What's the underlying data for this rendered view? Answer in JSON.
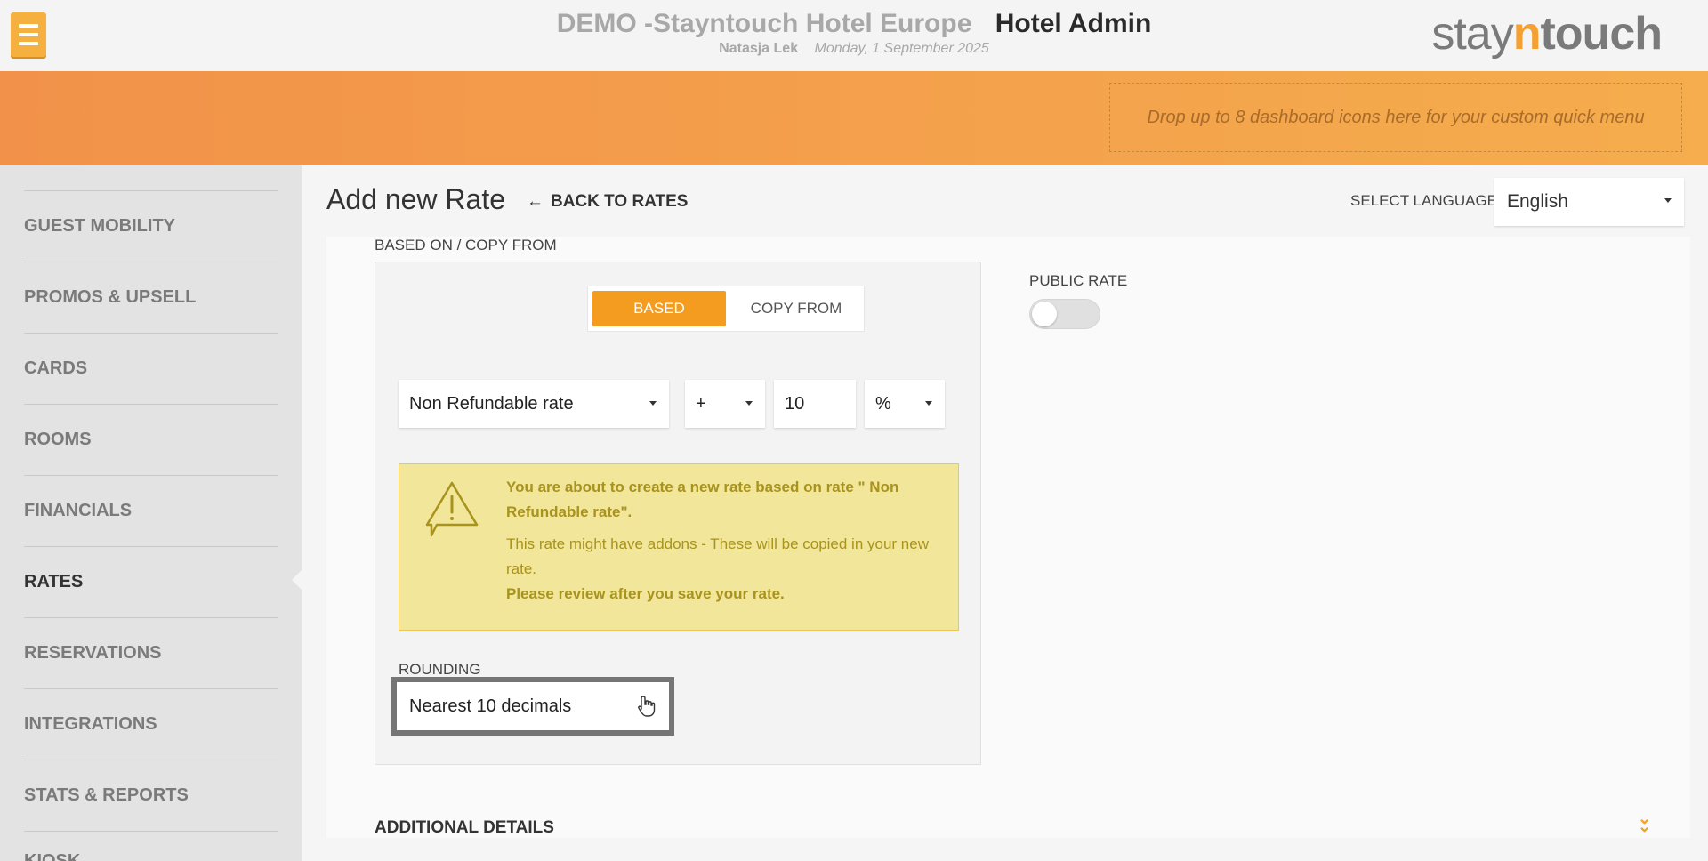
{
  "header": {
    "hotel_name": "DEMO -Stayntouch Hotel Europe",
    "app_name": "Hotel Admin",
    "user": "Natasja Lek",
    "date": "Monday, 1 September 2025",
    "logo": {
      "stay": "stay",
      "n": "n",
      "touch": "touch"
    }
  },
  "quick_menu": {
    "placeholder": "Drop up to 8 dashboard icons here for your custom quick menu"
  },
  "sidebar": {
    "items": [
      {
        "label": "GUEST MOBILITY",
        "active": false
      },
      {
        "label": "PROMOS & UPSELL",
        "active": false
      },
      {
        "label": "CARDS",
        "active": false
      },
      {
        "label": "ROOMS",
        "active": false
      },
      {
        "label": "FINANCIALS",
        "active": false
      },
      {
        "label": "RATES",
        "active": true
      },
      {
        "label": "RESERVATIONS",
        "active": false
      },
      {
        "label": "INTEGRATIONS",
        "active": false
      },
      {
        "label": "STATS & REPORTS",
        "active": false
      },
      {
        "label": "KIOSK",
        "active": false
      }
    ]
  },
  "page": {
    "title": "Add new Rate",
    "back_label": "BACK TO RATES",
    "language_label": "SELECT LANGUAGE",
    "language_value": "English"
  },
  "form": {
    "based_on_label": "BASED ON / COPY FROM",
    "mode_based": "BASED",
    "mode_copy": "COPY FROM",
    "base_rate": "Non Refundable rate",
    "operator": "+",
    "amount": "10",
    "unit": "%",
    "warning": {
      "title": "You are about to create a new rate based on rate \" Non Refundable rate\".",
      "body": "This rate might have addons - These will be copied in your new rate.",
      "note": "Please review after you save your rate."
    },
    "rounding_label": "ROUNDING",
    "rounding_value": "Nearest 10 decimals",
    "public_rate_label": "PUBLIC RATE",
    "public_rate_on": false,
    "additional_details": "ADDITIONAL DETAILS"
  },
  "colors": {
    "accent": "#f39c1f",
    "warning_bg": "#f1e69a",
    "warning_text": "#a8931e"
  }
}
